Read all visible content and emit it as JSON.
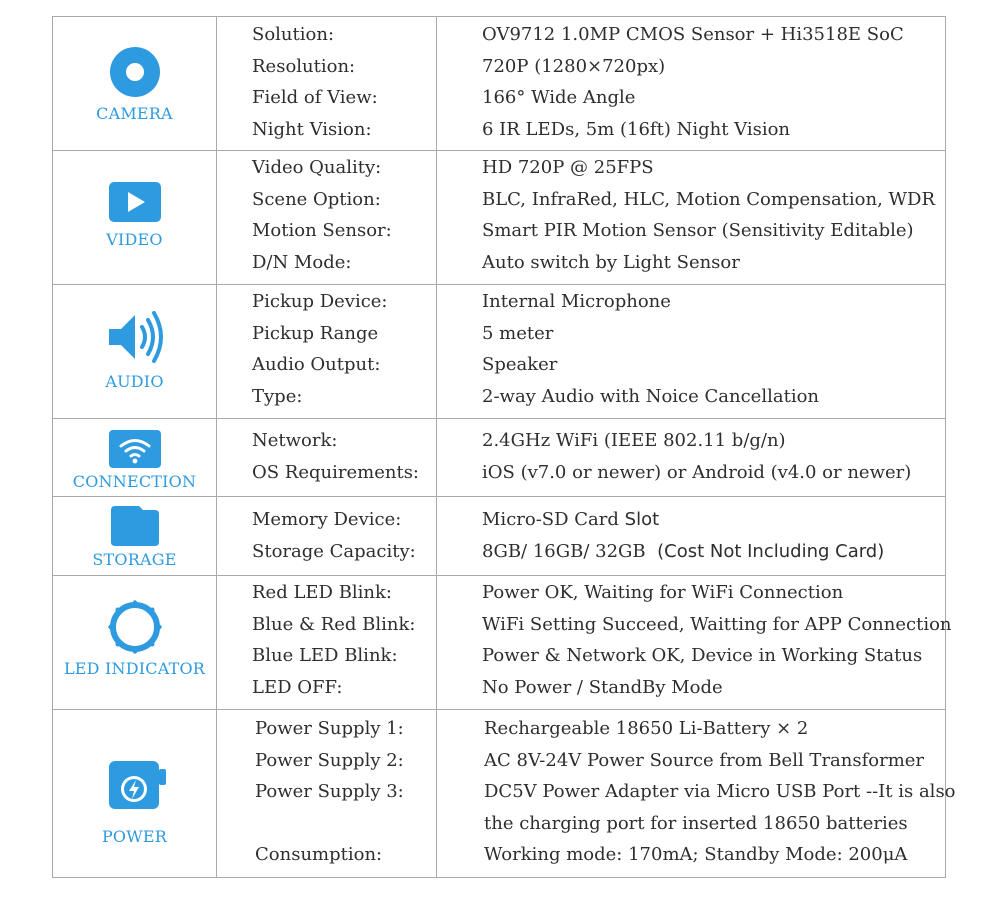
{
  "sections": [
    {
      "label": "CAMERA",
      "icon": "camera-lens-icon",
      "rows": [
        {
          "key": "Solution:",
          "value": "OV9712 1.0MP CMOS Sensor + Hi3518E SoC"
        },
        {
          "key": "Resolution:",
          "value": "720P (1280×720px)"
        },
        {
          "key": "Field of View:",
          "value": "166° Wide Angle"
        },
        {
          "key": "Night Vision:",
          "value": "6 IR LEDs, 5m (16ft) Night Vision"
        }
      ]
    },
    {
      "label": "VIDEO",
      "icon": "play-icon",
      "rows": [
        {
          "key": "Video Quality:",
          "value": "HD 720P @ 25FPS"
        },
        {
          "key": "Scene Option:",
          "value": "BLC, InfraRed, HLC, Motion Compensation, WDR"
        },
        {
          "key": "Motion Sensor:",
          "value": "Smart PIR Motion Sensor (Sensitivity Editable)"
        },
        {
          "key": "D/N Mode:",
          "value": "Auto switch by Light Sensor"
        }
      ]
    },
    {
      "label": "AUDIO",
      "icon": "speaker-icon",
      "rows": [
        {
          "key": "Pickup Device:",
          "value": "Internal Microphone"
        },
        {
          "key": "Pickup Range",
          "value": "5 meter"
        },
        {
          "key": "Audio Output:",
          "value": "Speaker"
        },
        {
          "key": "Type:",
          "value": "2-way Audio with Noice Cancellation"
        }
      ]
    },
    {
      "label": "CONNECTION",
      "icon": "wifi-icon",
      "rows": [
        {
          "key": "Network:",
          "value": "2.4GHz WiFi (IEEE 802.11 b/g/n)"
        },
        {
          "key": "OS Requirements:",
          "value": "iOS (v7.0 or newer) or Android (v4.0 or newer)"
        }
      ]
    },
    {
      "label": "STORAGE",
      "icon": "sd-card-icon",
      "rows": [
        {
          "key": "Memory Device:",
          "value": "Micro-SD Card",
          "value_extra": " Slot"
        },
        {
          "key": "Storage Capacity:",
          "value": "8GB/ 16GB/ 32GB",
          "value_extra": "  (Cost Not Including Card)"
        }
      ]
    },
    {
      "label": "LED INDICATOR",
      "icon": "led-ring-icon",
      "rows": [
        {
          "key": "Red LED Blink:",
          "value": "Power OK, Waiting for WiFi Connection"
        },
        {
          "key": "Blue & Red Blink:",
          "value": "WiFi Setting Succeed, Waitting for APP Connection"
        },
        {
          "key": "Blue LED Blink:",
          "value": "Power & Network OK, Device in Working Status"
        },
        {
          "key": "LED OFF:",
          "value": "No Power / StandBy Mode"
        }
      ]
    },
    {
      "label": "POWER",
      "icon": "battery-charging-icon",
      "rows": [
        {
          "key": "Power Supply 1:",
          "value": "Rechargeable 18650 Li-Battery × 2"
        },
        {
          "key": "Power Supply 2:",
          "value": "AC 8V-24V Power Source from Bell Transformer"
        },
        {
          "key": "Power Supply 3:",
          "value": "DC5V Power Adapter via Micro USB Port --It is also"
        },
        {
          "key": "",
          "value": "the charging port for inserted 18650 batteries"
        },
        {
          "key": "Consumption:",
          "value": "Working mode: 170mA; Standby Mode: 200μA"
        }
      ]
    }
  ],
  "colors": {
    "accent": "#2e9be0",
    "border": "#a9a9a9",
    "text": "#2e2e2e"
  }
}
